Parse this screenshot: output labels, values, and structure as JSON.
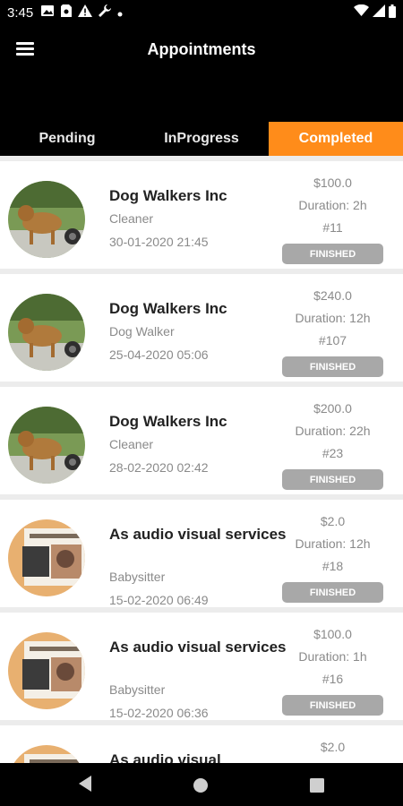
{
  "status_bar": {
    "time": "3:45",
    "left_icons": [
      "image-icon",
      "sim-card-icon",
      "warning-icon",
      "wrench-icon",
      "dot-icon"
    ],
    "right_icons": [
      "wifi-icon",
      "cellular-signal-icon",
      "battery-icon"
    ]
  },
  "app_bar": {
    "menu_icon": "menu-icon",
    "title": "Appointments"
  },
  "tabs": [
    {
      "label": "Pending",
      "active": false
    },
    {
      "label": "InProgress",
      "active": false
    },
    {
      "label": "Completed",
      "active": true
    }
  ],
  "colors": {
    "accent": "#ff8c1a",
    "bar_background": "#000000",
    "badge_background": "#a8a8a8",
    "secondary_text": "#8a8a8a"
  },
  "appointments": [
    {
      "name": "Dog Walkers Inc",
      "role": "Cleaner",
      "datetime": "30-01-2020 21:45",
      "price": "$100.0",
      "duration": "Duration: 2h",
      "number": "#11",
      "status": "FINISHED",
      "avatar": "dog-photo"
    },
    {
      "name": "Dog Walkers Inc",
      "role": "Dog Walker",
      "datetime": "25-04-2020 05:06",
      "price": "$240.0",
      "duration": "Duration: 12h",
      "number": "#107",
      "status": "FINISHED",
      "avatar": "dog-photo"
    },
    {
      "name": "Dog Walkers Inc",
      "role": "Cleaner",
      "datetime": "28-02-2020 02:42",
      "price": "$200.0",
      "duration": "Duration: 22h",
      "number": "#23",
      "status": "FINISHED",
      "avatar": "dog-photo"
    },
    {
      "name": "As audio visual services",
      "role": "Babysitter",
      "datetime": "15-02-2020 06:49",
      "price": "$2.0",
      "duration": "Duration: 12h",
      "number": "#18",
      "status": "FINISHED",
      "avatar": "audio-visual-photo"
    },
    {
      "name": "As audio visual services",
      "role": "Babysitter",
      "datetime": "15-02-2020 06:36",
      "price": "$100.0",
      "duration": "Duration: 1h",
      "number": "#16",
      "status": "FINISHED",
      "avatar": "audio-visual-photo"
    },
    {
      "name": "As audio visual",
      "role": "",
      "datetime": "",
      "price": "$2.0",
      "duration": "",
      "number": "",
      "status": "",
      "avatar": "audio-visual-photo"
    }
  ],
  "nav_bar": {
    "icons": [
      "back-icon",
      "home-icon",
      "recents-icon"
    ]
  }
}
